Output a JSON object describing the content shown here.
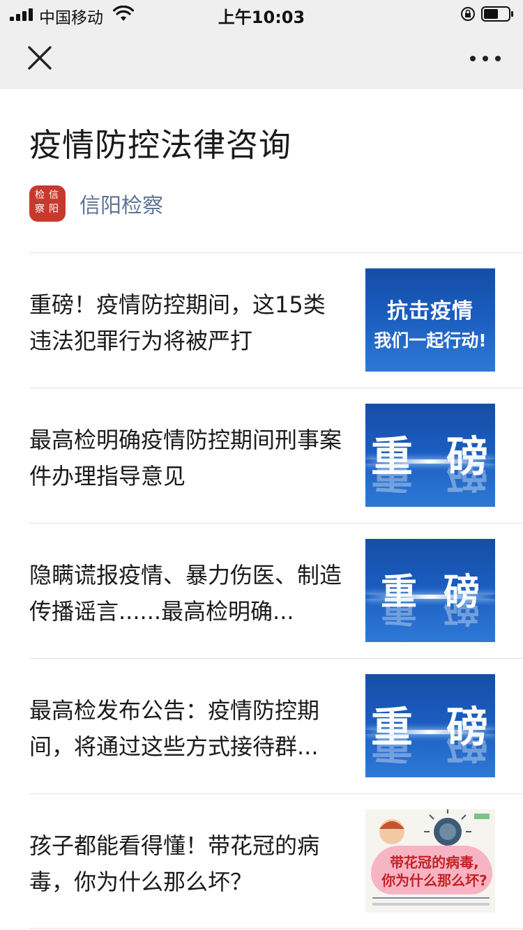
{
  "status_bar": {
    "carrier": "中国移动",
    "time": "上午10:03",
    "icons": [
      "signal-icon",
      "wifi-icon",
      "rotation-lock-icon",
      "battery-icon"
    ]
  },
  "nav": {
    "close_icon": "close-icon",
    "more_icon": "more-icon"
  },
  "page": {
    "title": "疫情防控法律咨询"
  },
  "account": {
    "logo_chars": [
      "信",
      "阳",
      "检",
      "察"
    ],
    "name": "信阳检察",
    "logo_color": "#c8392d",
    "name_color": "#5e7396"
  },
  "articles": [
    {
      "title": "重磅！疫情防控期间，这15类违法犯罪行为将被严打",
      "thumb": {
        "line1": "抗击疫情",
        "line2": "我们一起行动!"
      }
    },
    {
      "title": "最高检明确疫情防控期间刑事案件办理指导意见",
      "thumb": {
        "left": "重",
        "right": "磅"
      }
    },
    {
      "title": "隐瞒谎报疫情、暴力伤医、制造传播谣言......最高检明确...",
      "thumb": {
        "left": "重",
        "right": "磅"
      }
    },
    {
      "title": "最高检发布公告：疫情防控期间，将通过这些方式接待群...",
      "thumb": {
        "left": "重",
        "right": "磅"
      }
    },
    {
      "title": "孩子都能看得懂！带花冠的病毒，你为什么那么坏？",
      "thumb": {
        "line1": "带花冠的病毒,",
        "line2": "你为什么那么坏?"
      }
    }
  ],
  "colors": {
    "bar_bg": "#efefef",
    "thumb_blue": "#1a5cbf",
    "divider": "#e2e2e2"
  }
}
